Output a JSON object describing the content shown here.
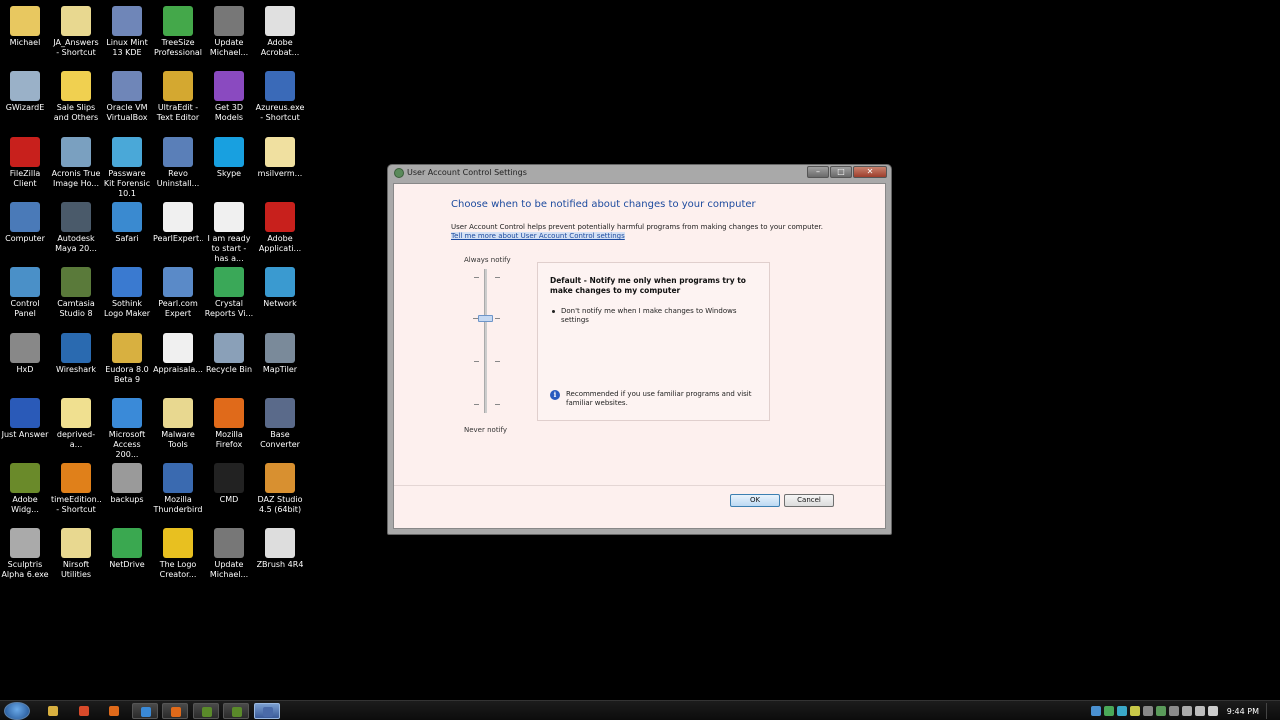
{
  "desktop": {
    "icons": [
      {
        "label": "Michael",
        "icon": "folder-icon",
        "color": "#e8c860"
      },
      {
        "label": "JA_Answers - Shortcut",
        "icon": "folder-icon",
        "color": "#e8d890"
      },
      {
        "label": "Linux Mint 13 KDE",
        "icon": "virtualbox-icon",
        "color": "#6f86b8"
      },
      {
        "label": "TreeSize Professional",
        "icon": "treesize-icon",
        "color": "#44a84a"
      },
      {
        "label": "Update Michael...",
        "icon": "update-icon",
        "color": "#777777"
      },
      {
        "label": "Adobe Acrobat...",
        "icon": "acrobat-icon",
        "color": "#e0e0e0"
      },
      {
        "label": "GWizardE",
        "icon": "gwizard-icon",
        "color": "#9ab1c8"
      },
      {
        "label": "Sale Slips and Others",
        "icon": "folder-star-icon",
        "color": "#f0d050"
      },
      {
        "label": "Oracle VM VirtualBox",
        "icon": "virtualbox-icon",
        "color": "#6f86b8"
      },
      {
        "label": "UltraEdit - Text Editor",
        "icon": "ultraedit-icon",
        "color": "#d4a830"
      },
      {
        "label": "Get 3D Models",
        "icon": "3d-store-icon",
        "color": "#8a4ac0"
      },
      {
        "label": "Azureus.exe - Shortcut",
        "icon": "azureus-icon",
        "color": "#3a6ab8"
      },
      {
        "label": "FileZilla Client",
        "icon": "filezilla-icon",
        "color": "#c8201c"
      },
      {
        "label": "Acronis True Image Ho...",
        "icon": "acronis-icon",
        "color": "#7aa0c0"
      },
      {
        "label": "Passware Kit Forensic 10.1",
        "icon": "passware-icon",
        "color": "#4aa8d8"
      },
      {
        "label": "Revo Uninstall...",
        "icon": "revo-icon",
        "color": "#5a7fb8"
      },
      {
        "label": "Skype",
        "icon": "skype-icon",
        "color": "#18a0e0"
      },
      {
        "label": "msilverm...",
        "icon": "folder-icon",
        "color": "#f0e0a0"
      },
      {
        "label": "Computer",
        "icon": "computer-icon",
        "color": "#4a7ab8"
      },
      {
        "label": "Autodesk Maya 20...",
        "icon": "maya-icon",
        "color": "#4a5a6a"
      },
      {
        "label": "Safari",
        "icon": "safari-icon",
        "color": "#3a8ad0"
      },
      {
        "label": "PearlExpert...",
        "icon": "document-icon",
        "color": "#f0f0f0"
      },
      {
        "label": "I am ready to start - has a...",
        "icon": "document-icon",
        "color": "#f0f0f0"
      },
      {
        "label": "Adobe Applicati...",
        "icon": "adobe-icon",
        "color": "#c8201c"
      },
      {
        "label": "Control Panel",
        "icon": "control-panel-icon",
        "color": "#4a90c8"
      },
      {
        "label": "Camtasia Studio 8",
        "icon": "camtasia-icon",
        "color": "#5a7a3a"
      },
      {
        "label": "Sothink Logo Maker",
        "icon": "sothink-icon",
        "color": "#3a7ad0"
      },
      {
        "label": "Pearl.com Expert",
        "icon": "pearl-icon",
        "color": "#5a8ac8"
      },
      {
        "label": "Crystal Reports Vi...",
        "icon": "crystal-icon",
        "color": "#3aa858"
      },
      {
        "label": "Network",
        "icon": "network-icon",
        "color": "#3a9ad0"
      },
      {
        "label": "HxD",
        "icon": "hxd-icon",
        "color": "#888888"
      },
      {
        "label": "Wireshark",
        "icon": "wireshark-icon",
        "color": "#2a6ab0"
      },
      {
        "label": "Eudora 8.0 Beta 9",
        "icon": "eudora-icon",
        "color": "#d8b040"
      },
      {
        "label": "Appraisala...",
        "icon": "document-icon",
        "color": "#f0f0f0"
      },
      {
        "label": "Recycle Bin",
        "icon": "recycle-bin-icon",
        "color": "#8aa0b8"
      },
      {
        "label": "MapTiler",
        "icon": "maptiler-icon",
        "color": "#7a8a9a"
      },
      {
        "label": "Just Answer",
        "icon": "help-icon",
        "color": "#2a5ab8"
      },
      {
        "label": "deprived-a...",
        "icon": "folder-icon",
        "color": "#f0e090"
      },
      {
        "label": "Microsoft Access 200...",
        "icon": "ie-icon",
        "color": "#3a8ad8"
      },
      {
        "label": "Malware Tools",
        "icon": "folder-icon",
        "color": "#e8d890"
      },
      {
        "label": "Mozilla Firefox",
        "icon": "firefox-icon",
        "color": "#e06a1a"
      },
      {
        "label": "Base Converter",
        "icon": "gear-icon",
        "color": "#5a6a8a"
      },
      {
        "label": "Adobe Widg...",
        "icon": "adobe-widget-icon",
        "color": "#6a8a2a"
      },
      {
        "label": "timeEdition... - Shortcut",
        "icon": "timeedition-icon",
        "color": "#e0801a"
      },
      {
        "label": "backups",
        "icon": "drive-icon",
        "color": "#9a9a9a"
      },
      {
        "label": "Mozilla Thunderbird",
        "icon": "thunderbird-icon",
        "color": "#3a6ab0"
      },
      {
        "label": "CMD",
        "icon": "cmd-icon",
        "color": "#222222"
      },
      {
        "label": "DAZ Studio 4.5 (64bit)",
        "icon": "daz-icon",
        "color": "#d89030"
      },
      {
        "label": "Sculptris Alpha 6.exe",
        "icon": "sculptris-icon",
        "color": "#aaaaaa"
      },
      {
        "label": "Nirsoft Utilities",
        "icon": "folder-icon",
        "color": "#e8d890"
      },
      {
        "label": "NetDrive",
        "icon": "netdrive-icon",
        "color": "#3aa850"
      },
      {
        "label": "The Logo Creator...",
        "icon": "logo-creator-icon",
        "color": "#e8c020"
      },
      {
        "label": "Update Michael...",
        "icon": "update-icon",
        "color": "#777777"
      },
      {
        "label": "ZBrush 4R4",
        "icon": "zbrush-icon",
        "color": "#dddddd"
      }
    ]
  },
  "dialog": {
    "title": "User Account Control Settings",
    "heading": "Choose when to be notified about changes to your computer",
    "description": "User Account Control helps prevent potentially harmful programs from making changes to your computer.",
    "learn_more_link": "Tell me more about User Account Control settings",
    "slider": {
      "top_label": "Always notify",
      "bottom_label": "Never notify",
      "level": 2,
      "levels": 4
    },
    "info": {
      "title": "Default - Notify me only when programs try to make changes to my computer",
      "bullet": "Don't notify me when I make changes to Windows settings",
      "note": "Recommended if you use familiar programs and visit familiar websites."
    },
    "buttons": {
      "ok": "OK",
      "cancel": "Cancel"
    },
    "window_buttons": {
      "minimize": "–",
      "maximize": "□",
      "close": "✕"
    }
  },
  "taskbar": {
    "apps": [
      {
        "name": "explorer-icon",
        "color": "#d8b040"
      },
      {
        "name": "chrome-icon",
        "color": "#d84a2a"
      },
      {
        "name": "firefox-icon",
        "color": "#e06a1a"
      },
      {
        "name": "ie-icon",
        "color": "#3a8ad8"
      },
      {
        "name": "firefox-icon",
        "color": "#e06a1a"
      },
      {
        "name": "camtasia-icon",
        "color": "#5a8a2a"
      },
      {
        "name": "camtasia-recorder-icon",
        "color": "#5a8a2a"
      },
      {
        "name": "uac-settings-icon",
        "color": "#4a6aa8"
      }
    ],
    "tray_icons": [
      {
        "name": "tray-app-icon",
        "color": "#4a90d0"
      },
      {
        "name": "tray-app-icon",
        "color": "#4aa858"
      },
      {
        "name": "tray-app-icon",
        "color": "#3aa8c8"
      },
      {
        "name": "tray-app-icon",
        "color": "#c8c848"
      },
      {
        "name": "tray-app-icon",
        "color": "#888888"
      },
      {
        "name": "tray-app-icon",
        "color": "#5a9a5a"
      },
      {
        "name": "tray-app-icon",
        "color": "#8a8a8a"
      },
      {
        "name": "tray-app-icon",
        "color": "#aaaaaa"
      },
      {
        "name": "flag-icon",
        "color": "#bbbbbb"
      },
      {
        "name": "volume-icon",
        "color": "#cccccc"
      }
    ],
    "clock": "9:44 PM"
  }
}
